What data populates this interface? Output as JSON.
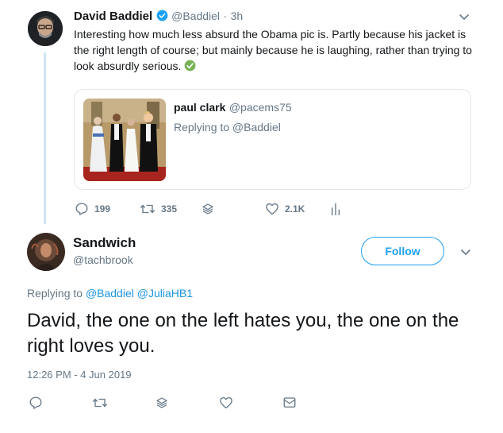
{
  "parent_tweet": {
    "name": "David Baddiel",
    "handle": "@Baddiel",
    "separator": "·",
    "time": "3h",
    "text": "Interesting how much less absurd the Obama pic is. Partly because his jacket is the right length of course; but mainly because he is laughing, rather than trying to look absurdly serious.",
    "quote": {
      "name": "paul clark",
      "handle": "@pacems75",
      "replying": "Replying to @Baddiel"
    },
    "actions": {
      "replies": "199",
      "retweets": "335",
      "likes": "2.1K"
    }
  },
  "main_tweet": {
    "name": "Sandwich",
    "handle": "@tachbrook",
    "follow_label": "Follow",
    "replying_prefix": "Replying to",
    "replying_to_1": "@Baddiel",
    "replying_to_2": "@JuliaHB1",
    "text": "David, the one on the left hates you, the one on the right loves you.",
    "timestamp": "12:26 PM - 4 Jun 2019"
  },
  "colors": {
    "accent": "#1da1f2",
    "link": "#1b95e0",
    "secondary_text": "#657786",
    "verified_check": "#1da1f2",
    "green_check": "#77b255"
  },
  "icons": [
    "chevron-down-icon",
    "verified-badge-icon",
    "green-check-icon",
    "reply-icon",
    "retweet-icon",
    "stack-icon",
    "heart-icon",
    "analytics-icon",
    "message-icon"
  ]
}
